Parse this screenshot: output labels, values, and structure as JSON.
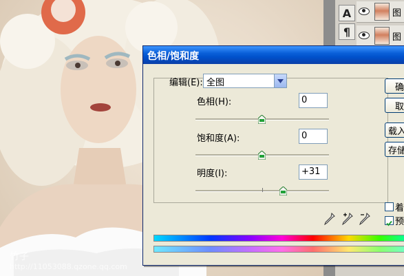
{
  "watermark": {
    "name": "竹子",
    "url": "http://11053088.qzone.qq.com"
  },
  "tools": {
    "type_tool_glyph": "A",
    "paragraph_tool_glyph": "¶"
  },
  "layers": [
    {
      "name": "图"
    },
    {
      "name": "图"
    }
  ],
  "dialog": {
    "title": "色相/饱和度",
    "edit_label": "编辑(E):",
    "edit_value": "全图",
    "hue_label": "色相(H):",
    "hue_value": "0",
    "saturation_label": "饱和度(A):",
    "saturation_value": "0",
    "lightness_label": "明度(I):",
    "lightness_value": "+31",
    "buttons": {
      "ok": "确定",
      "cancel": "取消",
      "load": "载入...",
      "save": "存储..."
    },
    "colorize_label": "着色",
    "colorize_checked": false,
    "preview_label": "预览",
    "preview_checked": true,
    "slider_levels": {
      "hue": 0,
      "saturation": 0,
      "lightness": 31
    }
  },
  "colors": {
    "titlebar": "#0058e6",
    "dialog_bg": "#ece9d8",
    "panel_bg": "#d4d0c8"
  }
}
